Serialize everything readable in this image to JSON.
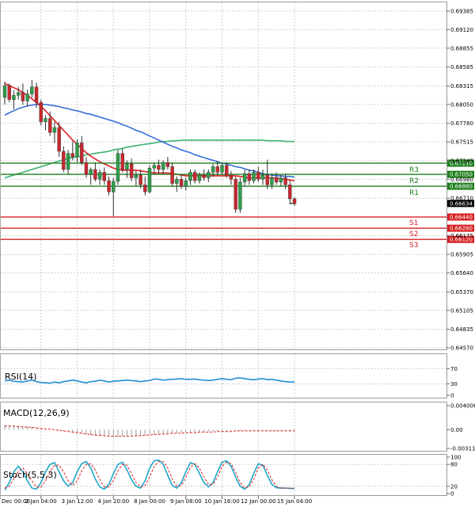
{
  "chart_data": {
    "type": "candlestick",
    "main_panel": {
      "price_axis_ticks": [
        "0.69385",
        "0.69120",
        "0.68855",
        "0.68585",
        "0.68315",
        "0.68050",
        "0.67780",
        "0.67515",
        "0.67245",
        "0.66980",
        "0.66710",
        "0.66175",
        "0.65905",
        "0.65640",
        "0.65370",
        "0.65105",
        "0.64835",
        "0.64570"
      ],
      "ylim": [
        0.6457,
        0.69385
      ],
      "current_price": "0.66634",
      "candles": [
        [
          0.6815,
          0.6838,
          0.6805,
          0.6832
        ],
        [
          0.6832,
          0.6835,
          0.6808,
          0.6812
        ],
        [
          0.6812,
          0.6825,
          0.6798,
          0.6818
        ],
        [
          0.6818,
          0.683,
          0.6812,
          0.6822
        ],
        [
          0.6822,
          0.6835,
          0.6805,
          0.681
        ],
        [
          0.681,
          0.6826,
          0.6802,
          0.682
        ],
        [
          0.682,
          0.684,
          0.6815,
          0.683
        ],
        [
          0.683,
          0.6836,
          0.68,
          0.6808
        ],
        [
          0.6808,
          0.6812,
          0.6775,
          0.678
        ],
        [
          0.678,
          0.679,
          0.6768,
          0.6785
        ],
        [
          0.6785,
          0.6795,
          0.676,
          0.6765
        ],
        [
          0.6765,
          0.678,
          0.675,
          0.6772
        ],
        [
          0.6772,
          0.678,
          0.673,
          0.6738
        ],
        [
          0.6738,
          0.6745,
          0.6708,
          0.6712
        ],
        [
          0.6712,
          0.674,
          0.6705,
          0.6735
        ],
        [
          0.6735,
          0.6752,
          0.6725,
          0.673
        ],
        [
          0.673,
          0.6755,
          0.6722,
          0.675
        ],
        [
          0.675,
          0.676,
          0.6718,
          0.6722
        ],
        [
          0.6722,
          0.673,
          0.67,
          0.6705
        ],
        [
          0.6705,
          0.6715,
          0.669,
          0.6712
        ],
        [
          0.6712,
          0.6722,
          0.6695,
          0.6698
        ],
        [
          0.6698,
          0.6712,
          0.669,
          0.6708
        ],
        [
          0.6708,
          0.6715,
          0.669,
          0.6696
        ],
        [
          0.6696,
          0.6702,
          0.6675,
          0.668
        ],
        [
          0.668,
          0.67,
          0.6645,
          0.6695
        ],
        [
          0.6695,
          0.674,
          0.669,
          0.6735
        ],
        [
          0.6735,
          0.6742,
          0.6708,
          0.6712
        ],
        [
          0.6712,
          0.6725,
          0.67,
          0.672
        ],
        [
          0.672,
          0.6728,
          0.6695,
          0.67
        ],
        [
          0.67,
          0.671,
          0.6688,
          0.6704
        ],
        [
          0.6704,
          0.6712,
          0.6685,
          0.669
        ],
        [
          0.669,
          0.6702,
          0.6675,
          0.668
        ],
        [
          0.668,
          0.6718,
          0.6678,
          0.6714
        ],
        [
          0.6714,
          0.6722,
          0.6705,
          0.6718
        ],
        [
          0.6718,
          0.6726,
          0.6706,
          0.6712
        ],
        [
          0.6712,
          0.6725,
          0.6705,
          0.6722
        ],
        [
          0.6722,
          0.673,
          0.6712,
          0.6716
        ],
        [
          0.6716,
          0.6722,
          0.6688,
          0.6692
        ],
        [
          0.6692,
          0.6702,
          0.668,
          0.6698
        ],
        [
          0.6698,
          0.6704,
          0.6684,
          0.6688
        ],
        [
          0.6688,
          0.67,
          0.6682,
          0.6696
        ],
        [
          0.6696,
          0.6712,
          0.669,
          0.6708
        ],
        [
          0.6708,
          0.6712,
          0.6692,
          0.6696
        ],
        [
          0.6696,
          0.6708,
          0.6692,
          0.6704
        ],
        [
          0.6704,
          0.6712,
          0.6696,
          0.67
        ],
        [
          0.67,
          0.6712,
          0.6694,
          0.6708
        ],
        [
          0.6708,
          0.672,
          0.6702,
          0.6716
        ],
        [
          0.6716,
          0.6724,
          0.6704,
          0.6708
        ],
        [
          0.6708,
          0.6722,
          0.6705,
          0.6718
        ],
        [
          0.6718,
          0.6722,
          0.67,
          0.6704
        ],
        [
          0.6704,
          0.671,
          0.669,
          0.6698
        ],
        [
          0.6698,
          0.6702,
          0.665,
          0.6655
        ],
        [
          0.6655,
          0.67,
          0.665,
          0.6694
        ],
        [
          0.6694,
          0.6712,
          0.6688,
          0.6706
        ],
        [
          0.6706,
          0.6712,
          0.669,
          0.6696
        ],
        [
          0.6696,
          0.6712,
          0.6692,
          0.6708
        ],
        [
          0.6708,
          0.6716,
          0.6694,
          0.6698
        ],
        [
          0.6698,
          0.6712,
          0.669,
          0.6704
        ],
        [
          0.6704,
          0.6726,
          0.6684,
          0.669
        ],
        [
          0.669,
          0.6706,
          0.6684,
          0.67
        ],
        [
          0.67,
          0.6708,
          0.669,
          0.6694
        ],
        [
          0.6694,
          0.6704,
          0.6688,
          0.67
        ],
        [
          0.67,
          0.6706,
          0.6684,
          0.669
        ],
        [
          0.669,
          0.6696,
          0.6662,
          0.667
        ],
        [
          0.667,
          0.6672,
          0.666,
          0.6663
        ]
      ],
      "sma_red": [
        0.6835,
        0.6832,
        0.6829,
        0.6826,
        0.6822,
        0.6818,
        0.6813,
        0.6808,
        0.6802,
        0.6796,
        0.6789,
        0.6782,
        0.6775,
        0.6768,
        0.6761,
        0.6754,
        0.6748,
        0.6742,
        0.6736,
        0.6731,
        0.6727,
        0.6723,
        0.672,
        0.6717,
        0.6714,
        0.6712,
        0.6711,
        0.6711,
        0.6711,
        0.6711,
        0.671,
        0.6709,
        0.6708,
        0.6707,
        0.6707,
        0.6707,
        0.6707,
        0.6706,
        0.6705,
        0.6704,
        0.6703,
        0.6703,
        0.6703,
        0.6703,
        0.6703,
        0.6703,
        0.6703,
        0.6703,
        0.6703,
        0.6703,
        0.6703,
        0.6703,
        0.6702,
        0.6701,
        0.67,
        0.67,
        0.67,
        0.67,
        0.67,
        0.67,
        0.67,
        0.6699,
        0.6698,
        0.6697,
        0.6696
      ],
      "sma_blue": [
        0.679,
        0.6793,
        0.6796,
        0.6799,
        0.6801,
        0.6803,
        0.6804,
        0.6805,
        0.6805,
        0.6805,
        0.6804,
        0.6803,
        0.6802,
        0.68,
        0.6799,
        0.6797,
        0.6796,
        0.6794,
        0.6792,
        0.6791,
        0.6789,
        0.6787,
        0.6785,
        0.6783,
        0.6781,
        0.6779,
        0.6776,
        0.6774,
        0.6771,
        0.6768,
        0.6766,
        0.6763,
        0.676,
        0.6757,
        0.6754,
        0.6751,
        0.6748,
        0.6745,
        0.6743,
        0.674,
        0.6738,
        0.6736,
        0.6733,
        0.6731,
        0.6729,
        0.6727,
        0.6725,
        0.6723,
        0.6721,
        0.672,
        0.6718,
        0.6716,
        0.6715,
        0.6713,
        0.6711,
        0.671,
        0.6708,
        0.6706,
        0.6705,
        0.6704,
        0.6703,
        0.6703,
        0.6702,
        0.6702,
        0.6701
      ],
      "sma_green": [
        0.67,
        0.6702,
        0.6704,
        0.6706,
        0.6708,
        0.671,
        0.6712,
        0.6714,
        0.6716,
        0.6718,
        0.672,
        0.6722,
        0.6724,
        0.6726,
        0.6728,
        0.6729,
        0.673,
        0.6731,
        0.6733,
        0.6734,
        0.6735,
        0.6736,
        0.6737,
        0.6738,
        0.674,
        0.6741,
        0.6742,
        0.6744,
        0.6745,
        0.6746,
        0.6747,
        0.6748,
        0.6749,
        0.675,
        0.6751,
        0.6752,
        0.6752,
        0.6753,
        0.6753,
        0.6754,
        0.6754,
        0.6754,
        0.6754,
        0.6754,
        0.6754,
        0.6754,
        0.6754,
        0.6754,
        0.6754,
        0.6754,
        0.6754,
        0.6754,
        0.6754,
        0.6754,
        0.6754,
        0.6754,
        0.6754,
        0.6754,
        0.6753,
        0.6753,
        0.6753,
        0.6753,
        0.6752,
        0.6752,
        0.6752
      ],
      "levels": [
        {
          "label": "R3",
          "value": "0.67210",
          "color": "#1e7f1e"
        },
        {
          "label": "R2",
          "value": "0.67050",
          "color": "#1e7f1e"
        },
        {
          "label": "R1",
          "value": "0.66880",
          "color": "#1e7f1e"
        },
        {
          "label": "S1",
          "value": "0.66440",
          "color": "#d62020"
        },
        {
          "label": "S2",
          "value": "0.66280",
          "color": "#d62020"
        },
        {
          "label": "S3",
          "value": "0.66120",
          "color": "#d62020"
        }
      ]
    },
    "rsi_panel": {
      "label": "RSI(14)",
      "ticks": [
        "70",
        "30",
        "0"
      ],
      "ylim": [
        0,
        100
      ],
      "values": [
        38,
        40,
        37,
        36,
        35,
        38,
        40,
        36,
        34,
        33,
        32,
        35,
        33,
        36,
        38,
        40,
        38,
        35,
        33,
        36,
        37,
        40,
        38,
        35,
        37,
        38,
        39,
        40,
        39,
        38,
        36,
        38,
        39,
        43,
        42,
        40,
        41,
        42,
        43,
        44,
        42,
        42,
        43,
        41,
        40,
        39,
        40,
        42,
        44,
        42,
        41,
        45,
        46,
        44,
        42,
        41,
        43,
        44,
        41,
        42,
        40,
        38,
        36,
        35,
        35
      ]
    },
    "macd_panel": {
      "label": "MACD(12,26,9)",
      "ticks": [
        "0.004006",
        "0.00",
        "-0.003115"
      ],
      "ylim": [
        -0.003115,
        0.004006
      ],
      "histogram": [
        0.0008,
        0.0008,
        0.0007,
        0.0007,
        0.0006,
        0.0006,
        0.0005,
        0.0004,
        0.0003,
        0.0002,
        0.0001,
        0.0,
        -0.0001,
        -0.0003,
        -0.0004,
        -0.0005,
        -0.0006,
        -0.0007,
        -0.0008,
        -0.0009,
        -0.001,
        -0.0011,
        -0.0011,
        -0.0012,
        -0.0012,
        -0.0012,
        -0.0011,
        -0.0011,
        -0.001,
        -0.001,
        -0.0009,
        -0.0009,
        -0.0008,
        -0.0008,
        -0.0007,
        -0.0007,
        -0.0006,
        -0.0006,
        -0.0006,
        -0.0005,
        -0.0005,
        -0.0005,
        -0.0004,
        -0.0004,
        -0.0004,
        -0.0003,
        -0.0003,
        -0.0003,
        -0.0003,
        -0.0002,
        -0.0002,
        -0.0002,
        -0.0002,
        -0.0002,
        -0.0002,
        -0.0002,
        -0.0002,
        -0.0002,
        -0.0002,
        -0.0002,
        -0.0002,
        -0.0002,
        -0.0002,
        -0.0002,
        -0.0002
      ],
      "signal": [
        0.0006,
        0.0006,
        0.0006,
        0.0005,
        0.0005,
        0.0004,
        0.0004,
        0.0003,
        0.0002,
        0.0001,
        0.0001,
        0.0,
        -0.0001,
        -0.0002,
        -0.0003,
        -0.0004,
        -0.0005,
        -0.0006,
        -0.0007,
        -0.0008,
        -0.0009,
        -0.0009,
        -0.001,
        -0.0011,
        -0.0011,
        -0.0011,
        -0.0011,
        -0.0011,
        -0.0011,
        -0.001,
        -0.001,
        -0.0009,
        -0.0009,
        -0.0008,
        -0.0008,
        -0.0007,
        -0.0007,
        -0.0006,
        -0.0006,
        -0.0006,
        -0.0005,
        -0.0005,
        -0.0005,
        -0.0004,
        -0.0004,
        -0.0004,
        -0.0004,
        -0.0003,
        -0.0003,
        -0.0003,
        -0.0003,
        -0.0002,
        -0.0002,
        -0.0002,
        -0.0002,
        -0.0002,
        -0.0002,
        -0.0002,
        -0.0002,
        -0.0002,
        -0.0002,
        -0.0002,
        -0.0002,
        -0.0002,
        -0.0002
      ]
    },
    "stoch_panel": {
      "label": "Stoch(5,5,3)",
      "ticks": [
        "100",
        "80",
        "20",
        "0"
      ],
      "ylim": [
        0,
        100
      ],
      "main": [
        10,
        30,
        60,
        75,
        60,
        35,
        15,
        12,
        30,
        60,
        80,
        85,
        60,
        35,
        20,
        30,
        60,
        82,
        88,
        70,
        40,
        18,
        12,
        25,
        55,
        80,
        86,
        65,
        38,
        20,
        15,
        35,
        70,
        90,
        92,
        80,
        50,
        22,
        15,
        30,
        60,
        85,
        80,
        55,
        30,
        18,
        30,
        60,
        86,
        90,
        75,
        45,
        20,
        12,
        25,
        55,
        82,
        78,
        50,
        25,
        16,
        15,
        15,
        14,
        14
      ],
      "signal": [
        15,
        20,
        40,
        60,
        70,
        55,
        35,
        18,
        18,
        35,
        60,
        78,
        78,
        60,
        35,
        22,
        35,
        62,
        80,
        82,
        65,
        38,
        18,
        18,
        35,
        62,
        80,
        78,
        55,
        30,
        18,
        22,
        45,
        75,
        88,
        88,
        70,
        40,
        20,
        22,
        45,
        72,
        82,
        70,
        45,
        25,
        25,
        45,
        75,
        86,
        82,
        58,
        30,
        15,
        18,
        40,
        70,
        80,
        65,
        38,
        20,
        15,
        15,
        15,
        14
      ]
    },
    "x_axis_ticks": [
      "Dec 00:00",
      "2 Jan 04:00",
      "3 Jan 12:00",
      "4 Jan 20:00",
      "8 Jan 00:00",
      "9 Jan 08:00",
      "10 Jan 16:00",
      "12 Jan 00:00",
      "15 Jan 04:00"
    ]
  }
}
